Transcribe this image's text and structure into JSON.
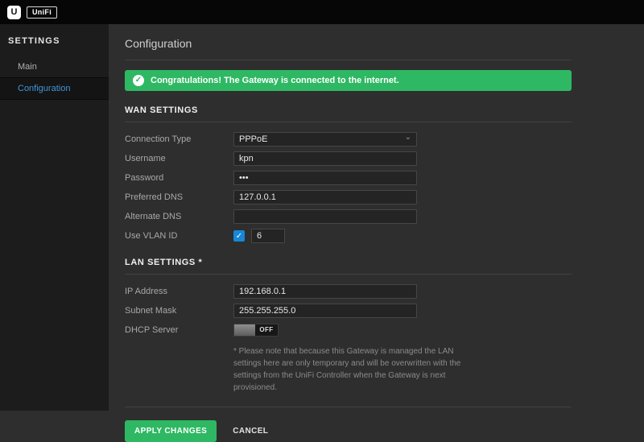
{
  "colors": {
    "success_green": "#2eb863",
    "accent_blue": "#3f95d8",
    "checkbox_blue": "#1787d6"
  },
  "icons": {
    "check": "✓",
    "chevron_down": "⌄"
  },
  "header": {
    "logo_letter": "U",
    "brand": "UniFi"
  },
  "sidebar": {
    "title": "SETTINGS",
    "items": [
      {
        "label": "Main"
      },
      {
        "label": "Configuration"
      }
    ]
  },
  "main": {
    "title": "Configuration",
    "banner": {
      "text": "Congratulations! The Gateway is connected to the internet."
    },
    "wan": {
      "heading": "WAN SETTINGS",
      "fields": [
        {
          "label": "Connection Type",
          "type": "select",
          "value": "PPPoE"
        },
        {
          "label": "Username",
          "type": "text",
          "value": "kpn"
        },
        {
          "label": "Password",
          "type": "password",
          "value": "•••"
        },
        {
          "label": "Preferred DNS",
          "type": "text",
          "value": "127.0.0.1"
        },
        {
          "label": "Alternate DNS",
          "type": "text",
          "value": ""
        },
        {
          "label": "Use VLAN ID",
          "type": "checkbox-input",
          "checked": true,
          "value": "6"
        }
      ]
    },
    "lan": {
      "heading": "LAN SETTINGS *",
      "fields": [
        {
          "label": "IP Address",
          "type": "text",
          "value": "192.168.0.1"
        },
        {
          "label": "Subnet Mask",
          "type": "text",
          "value": "255.255.255.0"
        },
        {
          "label": "DHCP Server",
          "type": "toggle",
          "state": "OFF"
        }
      ],
      "note": "* Please note that because this Gateway is managed the LAN settings here are only temporary and will be overwritten with the settings from the UniFi Controller when the Gateway is next provisioned."
    },
    "actions": {
      "apply": "APPLY CHANGES",
      "cancel": "CANCEL"
    }
  }
}
